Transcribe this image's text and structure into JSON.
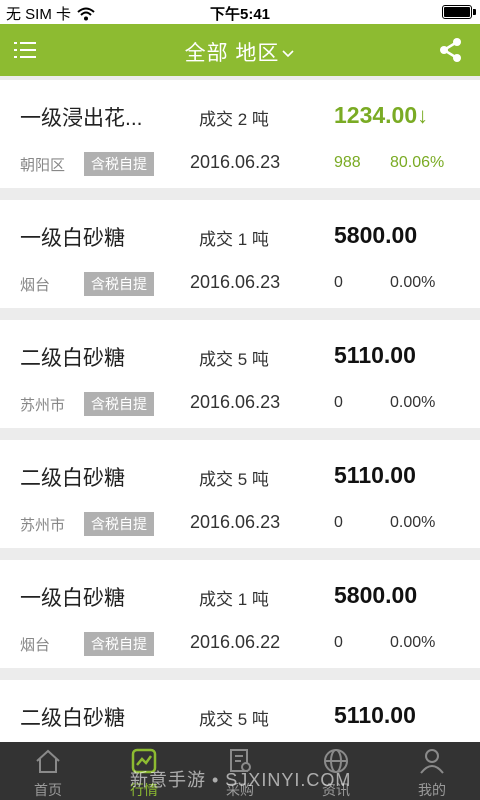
{
  "status": {
    "carrier": "无 SIM 卡",
    "time": "下午5:41"
  },
  "nav": {
    "title": "全部 地区",
    "menu_icon": "list-menu-icon",
    "share_icon": "share-icon"
  },
  "listings": [
    {
      "name": "一级浸出花...",
      "deal": "成交 2 吨",
      "price": "1234.00",
      "trend": "down",
      "region": "朝阳区",
      "tag": "含税自提",
      "date": "2016.06.23",
      "volume": "988",
      "percent": "80.06%",
      "highlight": true
    },
    {
      "name": "一级白砂糖",
      "deal": "成交 1 吨",
      "price": "5800.00",
      "trend": "",
      "region": "烟台",
      "tag": "含税自提",
      "date": "2016.06.23",
      "volume": "0",
      "percent": "0.00%",
      "highlight": false
    },
    {
      "name": "二级白砂糖",
      "deal": "成交 5 吨",
      "price": "5110.00",
      "trend": "",
      "region": "苏州市",
      "tag": "含税自提",
      "date": "2016.06.23",
      "volume": "0",
      "percent": "0.00%",
      "highlight": false
    },
    {
      "name": "二级白砂糖",
      "deal": "成交 5 吨",
      "price": "5110.00",
      "trend": "",
      "region": "苏州市",
      "tag": "含税自提",
      "date": "2016.06.23",
      "volume": "0",
      "percent": "0.00%",
      "highlight": false
    },
    {
      "name": "一级白砂糖",
      "deal": "成交 1 吨",
      "price": "5800.00",
      "trend": "",
      "region": "烟台",
      "tag": "含税自提",
      "date": "2016.06.22",
      "volume": "0",
      "percent": "0.00%",
      "highlight": false
    },
    {
      "name": "二级白砂糖",
      "deal": "成交 5 吨",
      "price": "5110.00",
      "trend": "",
      "region": "",
      "tag": "",
      "date": "",
      "volume": "",
      "percent": "",
      "highlight": false
    }
  ],
  "tabs": [
    {
      "label": "首页",
      "icon": "home-icon",
      "active": false
    },
    {
      "label": "行情",
      "icon": "chart-icon",
      "active": true
    },
    {
      "label": "采购",
      "icon": "purchase-icon",
      "active": false
    },
    {
      "label": "资讯",
      "icon": "globe-icon",
      "active": false
    },
    {
      "label": "我的",
      "icon": "user-icon",
      "active": false
    }
  ],
  "watermark": "新意手游 • SJXINYI.COM",
  "colors": {
    "accent": "#8dbb31",
    "up_text": "#7aab24",
    "tab_bar": "#333333"
  }
}
